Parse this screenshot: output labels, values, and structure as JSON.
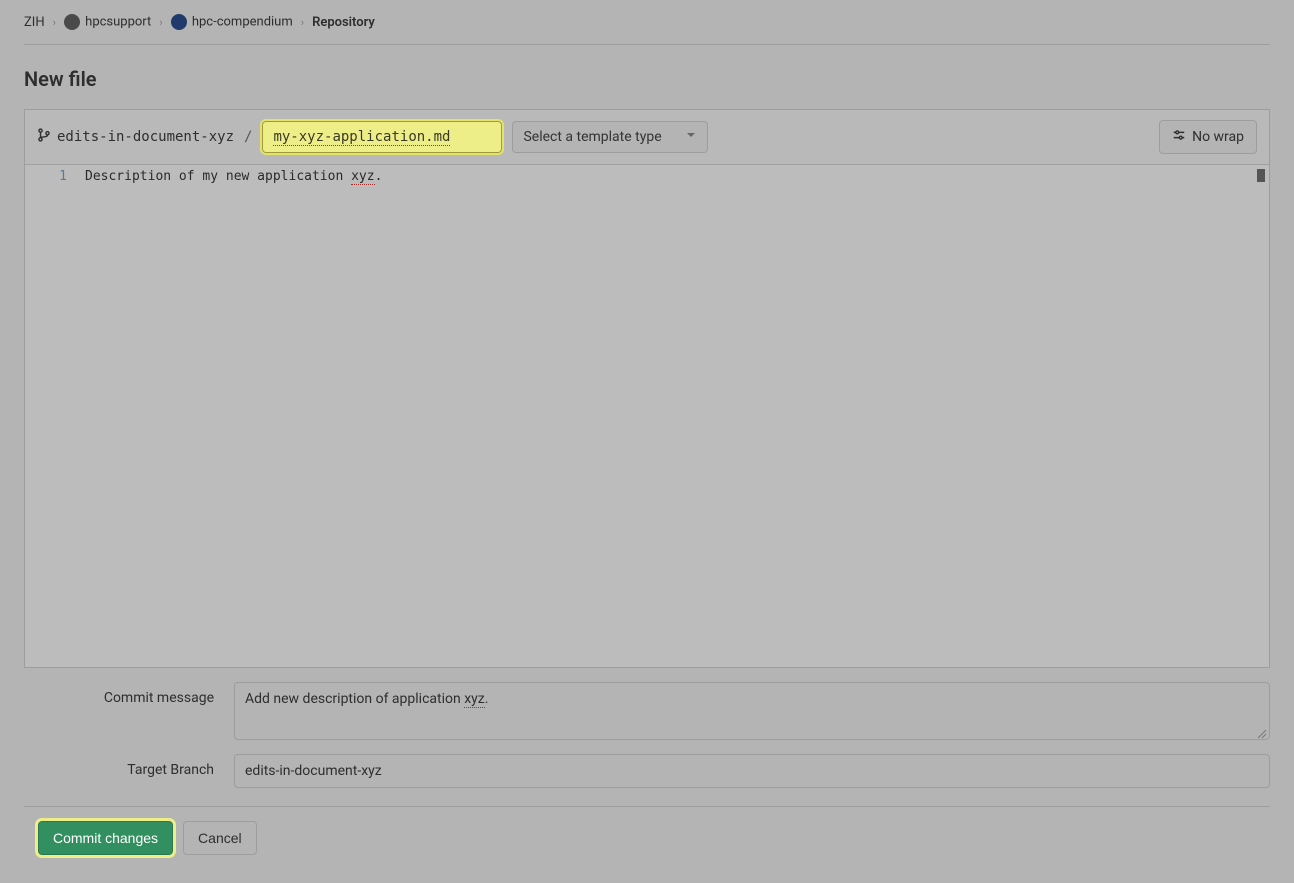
{
  "breadcrumbs": {
    "items": [
      {
        "label": "ZIH",
        "avatar": null
      },
      {
        "label": "hpcsupport",
        "avatar": "grey"
      },
      {
        "label": "hpc-compendium",
        "avatar": "blue"
      },
      {
        "label": "Repository",
        "avatar": null
      }
    ]
  },
  "page_title": "New file",
  "toolbar": {
    "branch_name": "edits-in-document-xyz",
    "filename_value": "my-xyz-application.md",
    "template_placeholder": "Select a template type",
    "wrap_label": "No wrap"
  },
  "editor": {
    "line_numbers": [
      "1"
    ],
    "content": "Description of my new application xyz."
  },
  "form": {
    "commit_message_label": "Commit message",
    "commit_message_value": "Add new description of application xyz.",
    "commit_message_prefix": "Add new description of application ",
    "commit_message_underlined": "xyz",
    "commit_message_suffix": ".",
    "target_branch_label": "Target Branch",
    "target_branch_value": "edits-in-document-xyz"
  },
  "actions": {
    "commit_label": "Commit changes",
    "cancel_label": "Cancel"
  }
}
